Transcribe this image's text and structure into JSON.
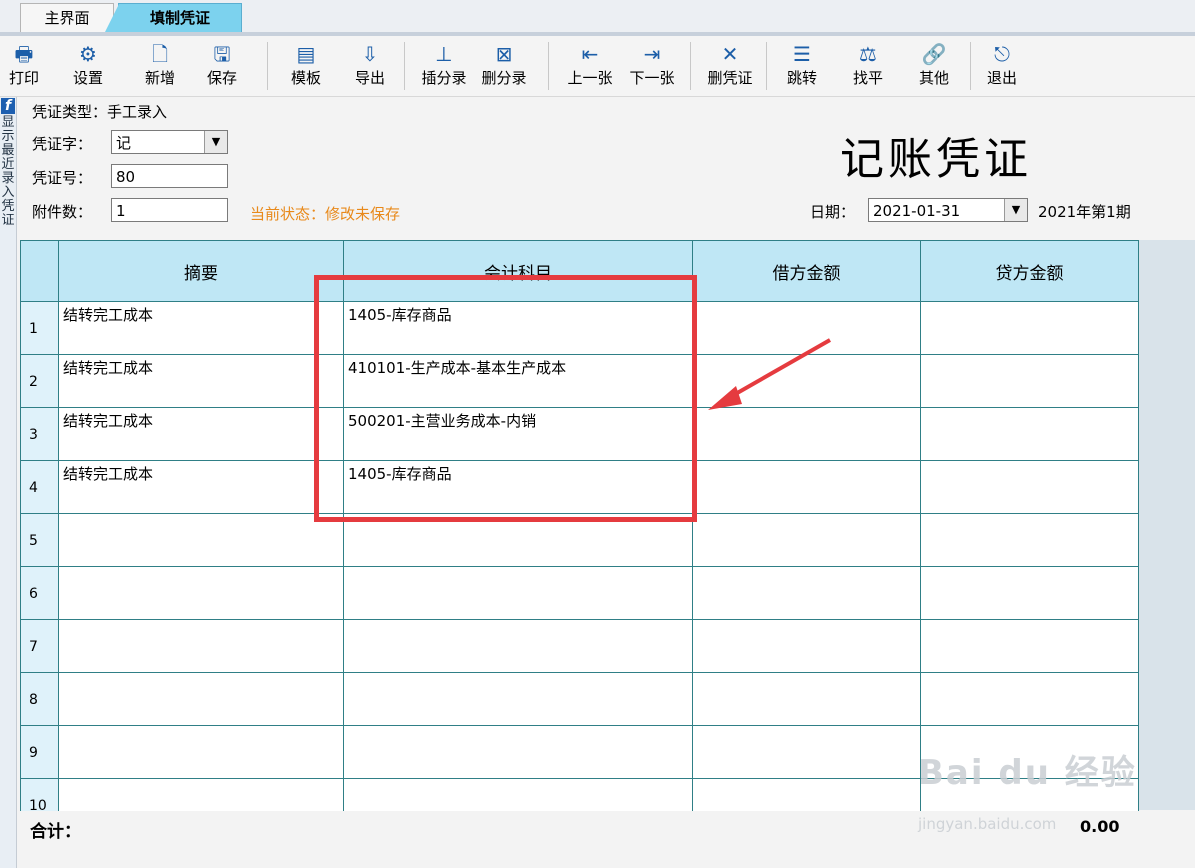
{
  "tabs": [
    {
      "label": "主界面",
      "active": false
    },
    {
      "label": "填制凭证",
      "active": true
    }
  ],
  "toolbar": [
    {
      "label": "打印",
      "icon": "printer-icon"
    },
    {
      "label": "设置",
      "icon": "settings-icon"
    },
    {
      "label": "新增",
      "icon": "new-doc-icon"
    },
    {
      "label": "保存",
      "icon": "save-icon"
    },
    {
      "label": "模板",
      "icon": "template-icon"
    },
    {
      "label": "导出",
      "icon": "export-icon"
    },
    {
      "label": "插分录",
      "icon": "insert-entry-icon"
    },
    {
      "label": "删分录",
      "icon": "delete-entry-icon"
    },
    {
      "label": "上一张",
      "icon": "prev-icon"
    },
    {
      "label": "下一张",
      "icon": "next-icon"
    },
    {
      "label": "删凭证",
      "icon": "delete-voucher-icon"
    },
    {
      "label": "跳转",
      "icon": "jump-icon"
    },
    {
      "label": "找平",
      "icon": "balance-icon"
    },
    {
      "label": "其他",
      "icon": "other-icon"
    },
    {
      "label": "退出",
      "icon": "exit-icon"
    }
  ],
  "sidebar": {
    "vertical_text": "显示最近录入凭证"
  },
  "header": {
    "voucher_type": "凭证类型：手工录入",
    "voucher_word_label": "凭证字：",
    "voucher_word_value": "记",
    "voucher_no_label": "凭证号：",
    "voucher_no_value": "80",
    "attachments_label": "附件数：",
    "attachments_value": "1",
    "status": "当前状态：修改未保存",
    "title": "记账凭证",
    "date_label": "日期：",
    "date_value": "2021-01-31",
    "period": "2021年第1期"
  },
  "table": {
    "columns": [
      "摘要",
      "会计科目",
      "借方金额",
      "贷方金额"
    ],
    "rows": [
      {
        "no": "1",
        "summary": "结转完工成本",
        "account": "1405-库存商品",
        "debit": "",
        "credit": ""
      },
      {
        "no": "2",
        "summary": "结转完工成本",
        "account": "410101-生产成本-基本生产成本",
        "debit": "",
        "credit": ""
      },
      {
        "no": "3",
        "summary": "结转完工成本",
        "account": "500201-主营业务成本-内销",
        "debit": "",
        "credit": ""
      },
      {
        "no": "4",
        "summary": "结转完工成本",
        "account": "1405-库存商品",
        "debit": "",
        "credit": ""
      },
      {
        "no": "5",
        "summary": "",
        "account": "",
        "debit": "",
        "credit": ""
      },
      {
        "no": "6",
        "summary": "",
        "account": "",
        "debit": "",
        "credit": ""
      },
      {
        "no": "7",
        "summary": "",
        "account": "",
        "debit": "",
        "credit": ""
      },
      {
        "no": "8",
        "summary": "",
        "account": "",
        "debit": "",
        "credit": ""
      },
      {
        "no": "9",
        "summary": "",
        "account": "",
        "debit": "",
        "credit": ""
      },
      {
        "no": "10",
        "summary": "",
        "account": "",
        "debit": "",
        "credit": ""
      }
    ]
  },
  "footer": {
    "total_label": "合计：",
    "total_value": "0.00"
  },
  "watermark": {
    "line1": "Bai du 经验",
    "line2": "jingyan.baidu.com"
  },
  "colors": {
    "accent": "#7cd2ee",
    "grid": "#2f7f86",
    "status": "#e8891a",
    "highlight": "#e53b3f"
  }
}
